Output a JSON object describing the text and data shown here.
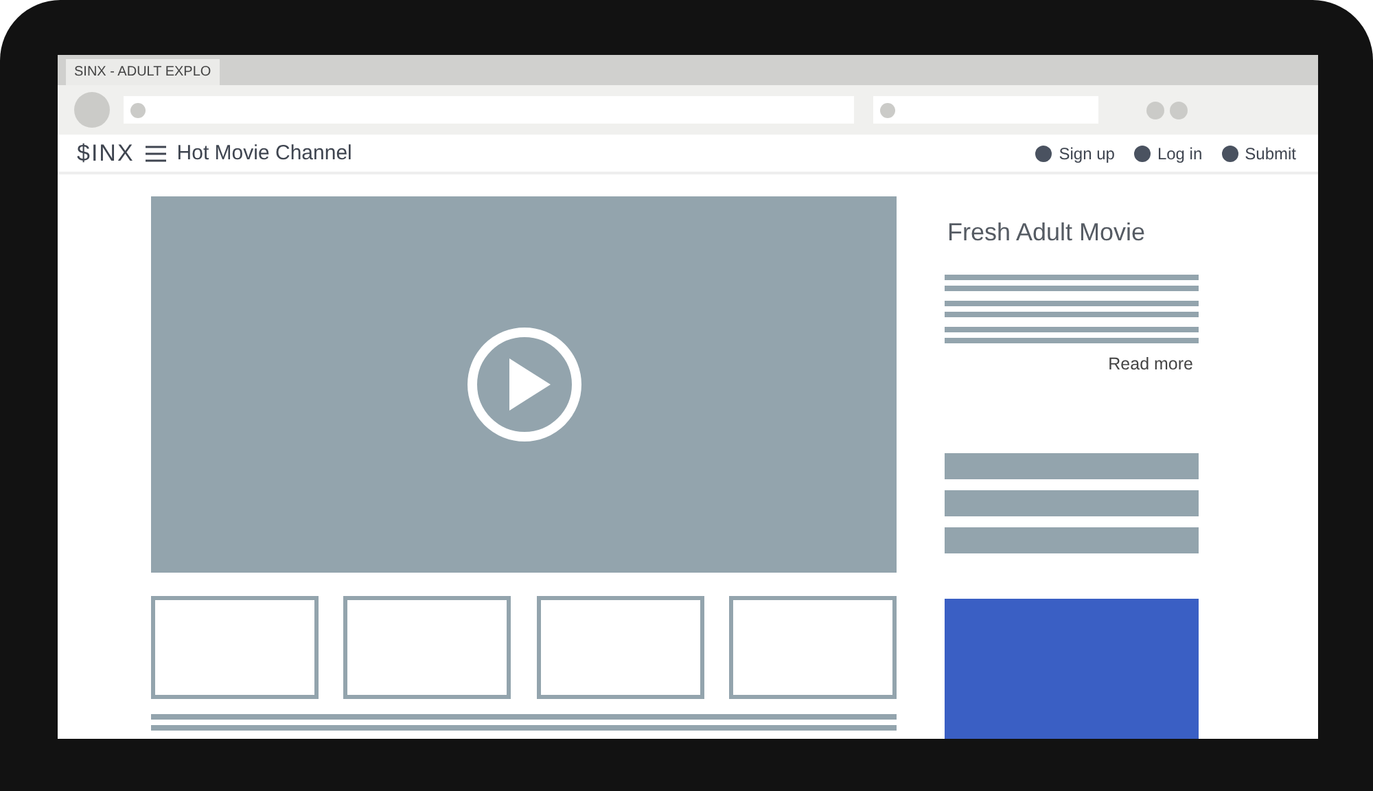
{
  "browser": {
    "tab": {
      "title": "SINX - ADULT EXPLO",
      "selected": true
    }
  },
  "nav": {
    "logo": "$INX",
    "title": "Hot Movie Channel",
    "links": [
      "Sign up",
      "Log in",
      "Submit"
    ]
  },
  "sidebar": {
    "title": "Fresh Adult Movie",
    "link": "Read more"
  }
}
